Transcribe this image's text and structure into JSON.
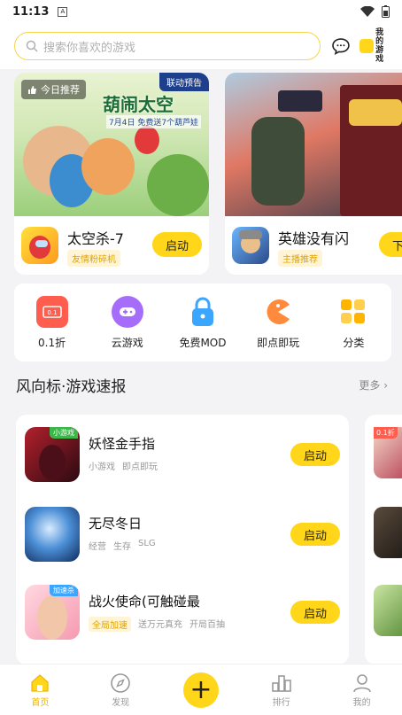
{
  "status": {
    "time": "11:13",
    "sim_glyph": "A"
  },
  "header": {
    "search_placeholder": "搜索你喜欢的游戏",
    "my_games_line1": "我的",
    "my_games_line2": "游戏"
  },
  "banners": [
    {
      "tag": "今日推荐",
      "badge": "联动预告",
      "art_title": "葫闹太空",
      "art_date": "7月4日 免费送7个葫芦娃",
      "name": "太空杀-7",
      "label": "友情粉碎机",
      "button": "启动"
    },
    {
      "name": "英雄没有闪",
      "label": "主播推荐",
      "button": "下载"
    }
  ],
  "quick_links": [
    {
      "label": "0.1折",
      "icon": "discount-ticket-icon",
      "color": "#ff5d4d"
    },
    {
      "label": "云游戏",
      "icon": "cloud-gamepad-icon",
      "color": "#a56dfa"
    },
    {
      "label": "免费MOD",
      "icon": "lock-icon",
      "color": "#3aa6ff"
    },
    {
      "label": "即点即玩",
      "icon": "pacman-icon",
      "color": "#ff8a3c"
    },
    {
      "label": "分类",
      "icon": "category-grid-icon",
      "color": "#ffb400"
    }
  ],
  "section": {
    "title": "风向标·游戏速报",
    "more": "更多"
  },
  "games": [
    {
      "name": "妖怪金手指",
      "badge": "小游戏",
      "tags": [
        "小游戏",
        "即点即玩"
      ],
      "highlight": "",
      "button": "启动"
    },
    {
      "name": "无尽冬日",
      "badge": "",
      "tags": [
        "经营",
        "生存",
        "SLG"
      ],
      "highlight": "",
      "button": "启动"
    },
    {
      "name": "战火使命(可触碰最",
      "badge": "加速杀",
      "tags": [
        "送万元真充",
        "开局百抽"
      ],
      "highlight": "全局加速",
      "button": "启动"
    }
  ],
  "peek_badge": "0.1折",
  "tabs": [
    {
      "label": "首页",
      "icon": "home-icon",
      "active": true
    },
    {
      "label": "发现",
      "icon": "compass-icon"
    },
    {
      "label": "",
      "icon": "plus-icon"
    },
    {
      "label": "排行",
      "icon": "ranking-icon"
    },
    {
      "label": "我的",
      "icon": "profile-icon"
    }
  ],
  "colors": {
    "accent": "#ffd61a",
    "tag_text": "#e0a300"
  }
}
